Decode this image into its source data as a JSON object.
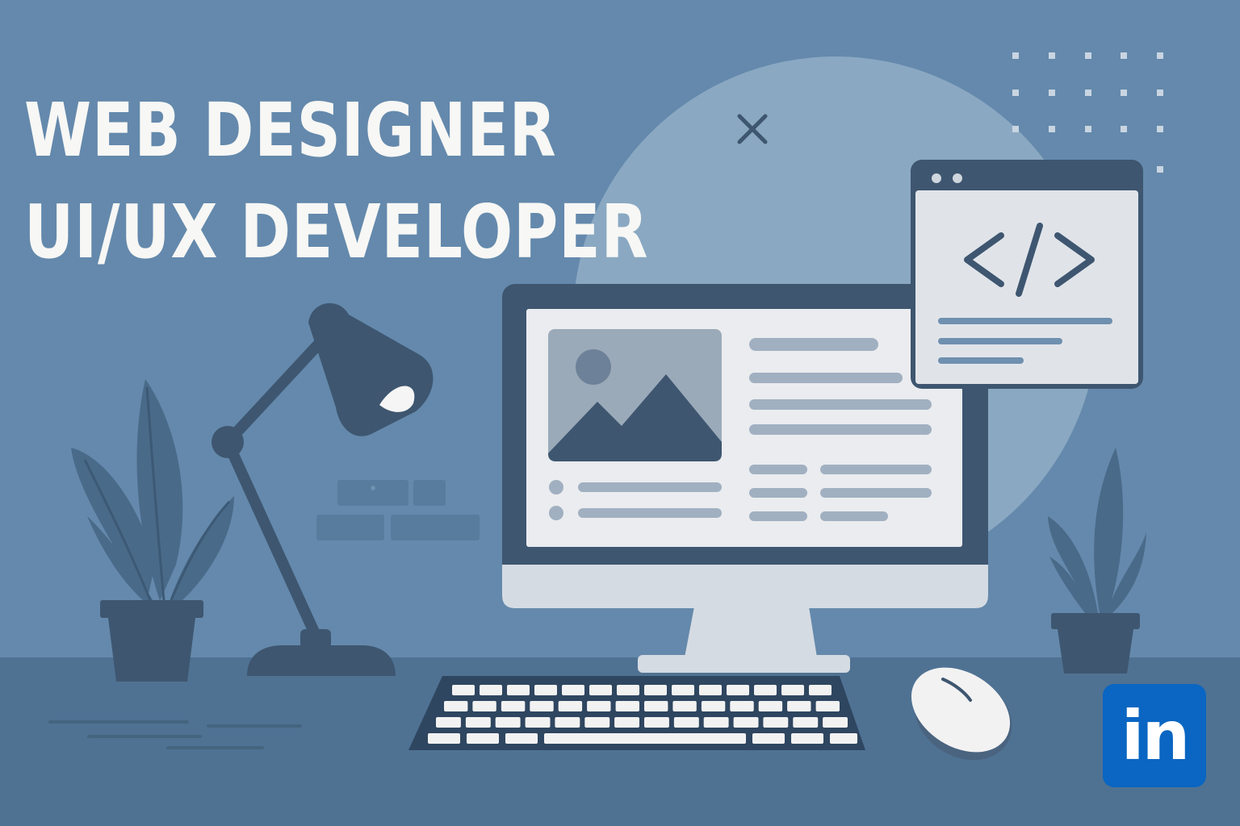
{
  "headline": {
    "line1": "WEB DESIGNER",
    "line2": "UI/UX DEVELOPER"
  },
  "social": {
    "badge_text": "in",
    "badge_icon": "linkedin-icon",
    "badge_color": "#0a66c2"
  },
  "palette": {
    "background": "#6489ac",
    "desk": "#4f7293",
    "dark": "#3e5670",
    "light": "#eaecef"
  },
  "code_window": {
    "symbol": "</>"
  },
  "icons": [
    "close-icon",
    "image-icon",
    "code-icon",
    "desk-lamp-icon",
    "plant-icon",
    "keyboard-icon",
    "mouse-icon",
    "monitor-icon"
  ]
}
